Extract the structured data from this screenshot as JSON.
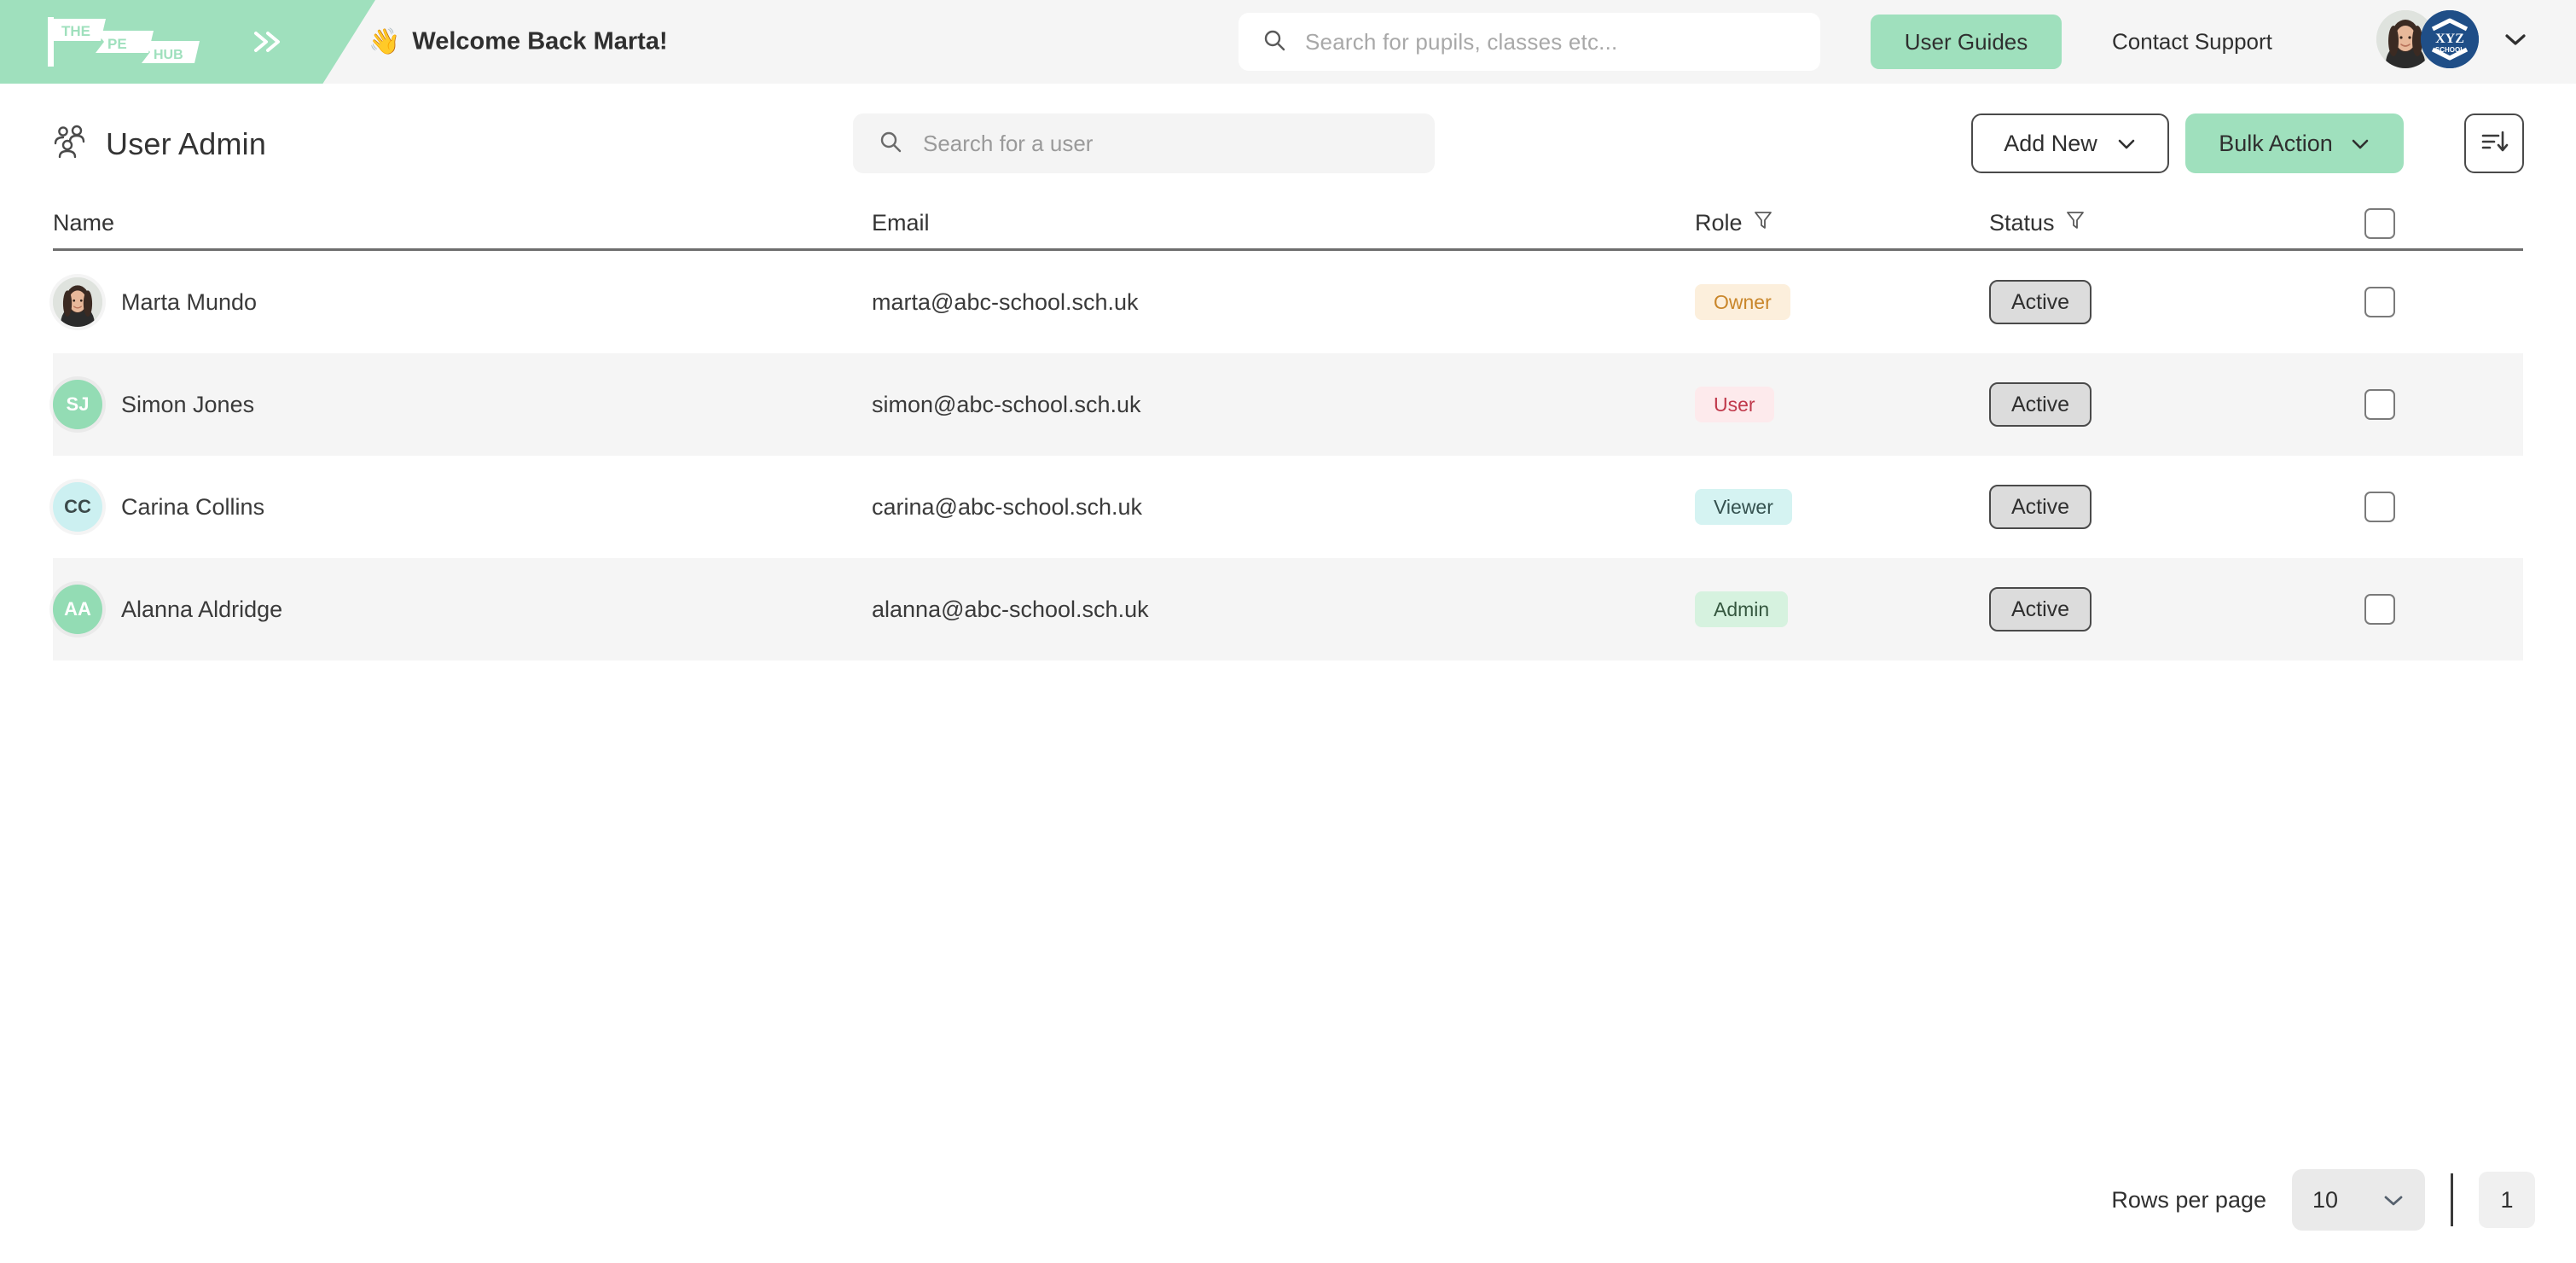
{
  "topbar": {
    "logo_lines": [
      "THE",
      "PE",
      "HUB"
    ],
    "expand_icon": "double-chevron-right-icon",
    "welcome_emoji": "👋",
    "welcome_text": "Welcome Back Marta!",
    "global_search_placeholder": "Search for pupils, classes etc...",
    "search_icon": "search-icon",
    "user_guides_label": "User Guides",
    "contact_support_label": "Contact Support",
    "school_badge": {
      "line1": "XYZ",
      "line2": "SCHOOL"
    },
    "account_chevron": "chevron-down-icon",
    "brand_green": "#9fe0bd",
    "bar_background": "#f5f5f5"
  },
  "page": {
    "title": "User Admin",
    "title_icon": "users-group-icon",
    "search_placeholder": "Search for a user",
    "add_new_label": "Add New",
    "bulk_action_label": "Bulk Action",
    "sort_icon": "sort-descending-icon"
  },
  "table": {
    "columns": [
      {
        "key": "name",
        "label": "Name",
        "filter": false
      },
      {
        "key": "email",
        "label": "Email",
        "filter": false
      },
      {
        "key": "role",
        "label": "Role",
        "filter": true
      },
      {
        "key": "status",
        "label": "Status",
        "filter": true
      }
    ],
    "select_all_checked": false,
    "rows": [
      {
        "name": "Marta Mundo",
        "email": "marta@abc-school.sch.uk",
        "avatar_type": "photo",
        "initials": "",
        "avatar_bg": "#dfe3de",
        "avatar_fg": "#ffffff",
        "role": "Owner",
        "role_bg": "#fcefdc",
        "role_fg": "#c9862a",
        "status": "Active",
        "checked": false
      },
      {
        "name": "Simon Jones",
        "email": "simon@abc-school.sch.uk",
        "avatar_type": "initials",
        "initials": "SJ",
        "avatar_bg": "#93dcb4",
        "avatar_fg": "#ffffff",
        "role": "User",
        "role_bg": "#fdeaec",
        "role_fg": "#c0394b",
        "status": "Active",
        "checked": false
      },
      {
        "name": "Carina Collins",
        "email": "carina@abc-school.sch.uk",
        "avatar_type": "initials",
        "initials": "CC",
        "avatar_bg": "#ccf0f1",
        "avatar_fg": "#3c4a4a",
        "role": "Viewer",
        "role_bg": "#d5f3f2",
        "role_fg": "#35514f",
        "status": "Active",
        "checked": false
      },
      {
        "name": "Alanna Aldridge",
        "email": "alanna@abc-school.sch.uk",
        "avatar_type": "initials",
        "initials": "AA",
        "avatar_bg": "#93dcb4",
        "avatar_fg": "#ffffff",
        "role": "Admin",
        "role_bg": "#d6f2df",
        "role_fg": "#35573f",
        "status": "Active",
        "checked": false
      }
    ]
  },
  "footer": {
    "rows_per_page_label": "Rows per page",
    "rows_per_page_value": "10",
    "rows_per_page_chevron": "chevron-down-icon",
    "current_page": "1"
  }
}
